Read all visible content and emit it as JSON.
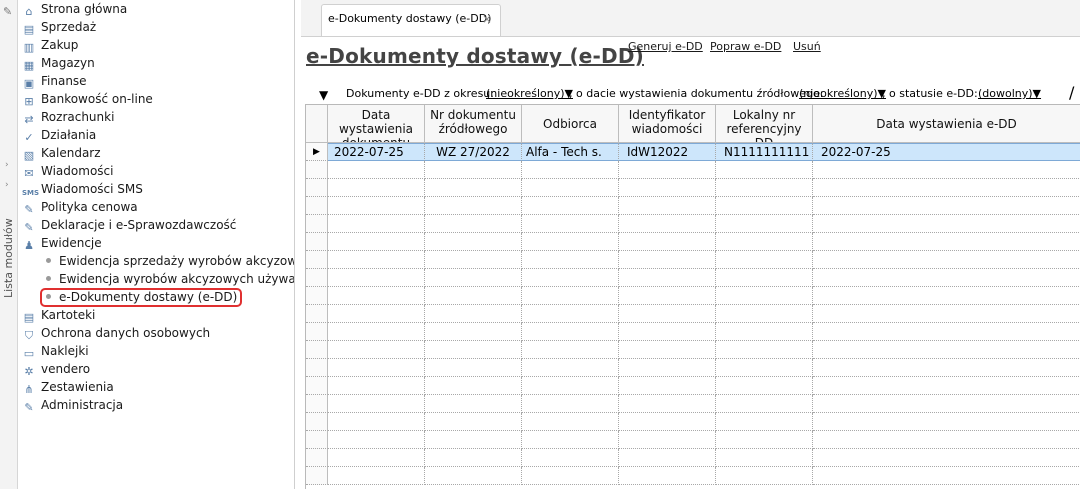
{
  "sidebar": {
    "rail_label": "Lista modułów",
    "modules": [
      {
        "label": "Strona główna",
        "icon": "home-icon"
      },
      {
        "label": "Sprzedaż",
        "icon": "sales-icon"
      },
      {
        "label": "Zakup",
        "icon": "cart-icon"
      },
      {
        "label": "Magazyn",
        "icon": "warehouse-icon"
      },
      {
        "label": "Finanse",
        "icon": "finance-icon"
      },
      {
        "label": "Bankowość on-line",
        "icon": "bank-icon"
      },
      {
        "label": "Rozrachunki",
        "icon": "settlements-icon"
      },
      {
        "label": "Działania",
        "icon": "actions-icon"
      },
      {
        "label": "Kalendarz",
        "icon": "calendar-icon"
      },
      {
        "label": "Wiadomości",
        "icon": "messages-icon"
      },
      {
        "label": "Wiadomości SMS",
        "icon": "sms-icon"
      },
      {
        "label": "Polityka cenowa",
        "icon": "price-policy-icon"
      },
      {
        "label": "Deklaracje i e-Sprawozdawczość",
        "icon": "declarations-icon"
      },
      {
        "label": "Ewidencje",
        "icon": "records-icon"
      }
    ],
    "sub_items": [
      {
        "label": "Ewidencja sprzedaży wyrobów akcyzowych"
      },
      {
        "label": "Ewidencja wyrobów akcyzowych używanyc"
      },
      {
        "label": "e-Dokumenty dostawy (e-DD)"
      }
    ],
    "modules_after": [
      {
        "label": "Kartoteki",
        "icon": "files-icon"
      },
      {
        "label": "Ochrona danych osobowych",
        "icon": "shield-icon"
      },
      {
        "label": "Naklejki",
        "icon": "labels-icon"
      },
      {
        "label": "vendero",
        "icon": "vendero-icon"
      },
      {
        "label": "Zestawienia",
        "icon": "reports-icon"
      },
      {
        "label": "Administracja",
        "icon": "admin-icon"
      }
    ]
  },
  "tab": {
    "label": "e-Dokumenty dostawy (e-DD)",
    "close": "×"
  },
  "page": {
    "title": "e-Dokumenty dostawy (e-DD)",
    "actions": {
      "generate": "Generuj e-DD",
      "fix": "Popraw e-DD",
      "delete": "Usuń"
    }
  },
  "filters": {
    "label1": "Dokumenty e-DD z okresu:",
    "value1": "(nieokreślony)▼",
    "label2": ", o dacie wystawienia dokumentu źródłowego:",
    "value2": "(nieokreślony)▼",
    "label3": ", o statusie e-DD:",
    "value3": "(dowolny)▼",
    "slash": "/"
  },
  "table": {
    "columns": [
      "Data wystawienia dokumentu źródłowego",
      "Nr dokumentu źródłowego",
      "Odbiorca",
      "Identyfikator wiadomości",
      "Lokalny nr referencyjny DD",
      "Data wystawienia e-DD"
    ],
    "rows": [
      [
        "2022-07-25",
        "WZ 27/2022",
        "Alfa - Tech s.",
        "IdW12022",
        "N1111111111",
        "2022-07-25"
      ]
    ],
    "current_row_marker": "▶"
  },
  "colors": {
    "selection": "#cde6fb",
    "highlight_outline": "#e03030"
  }
}
